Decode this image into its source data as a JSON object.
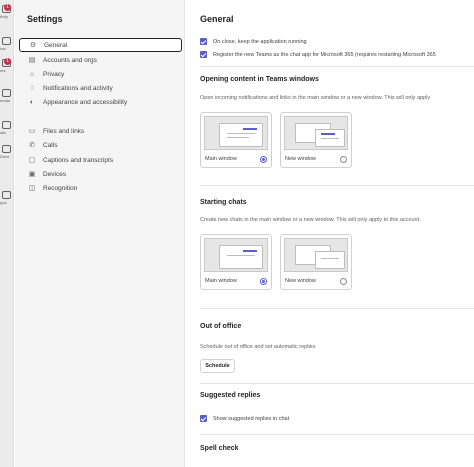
{
  "rail": {
    "items": [
      {
        "icon": "activity-icon",
        "caption": "tivity",
        "badge": "1"
      },
      {
        "icon": "chat-icon",
        "caption": "hat",
        "badge": ""
      },
      {
        "icon": "teams-icon",
        "caption": "ms",
        "badge": "1"
      },
      {
        "icon": "calendar-icon",
        "caption": "endar",
        "badge": ""
      },
      {
        "icon": "calls-icon",
        "caption": "alls",
        "badge": ""
      },
      {
        "icon": "onedrive-icon",
        "caption": "Drive",
        "badge": ""
      },
      {
        "icon": "apps-icon",
        "caption": "pps",
        "badge": ""
      }
    ]
  },
  "nav": {
    "title": "Settings",
    "items": [
      {
        "label": "General",
        "icon": "gear-icon"
      },
      {
        "label": "Accounts and orgs",
        "icon": "accounts-icon"
      },
      {
        "label": "Privacy",
        "icon": "lock-icon"
      },
      {
        "label": "Notifications and activity",
        "icon": "bell-icon"
      },
      {
        "label": "Appearance and accessibility",
        "icon": "appearance-icon"
      },
      {
        "label": "Files and links",
        "icon": "file-icon"
      },
      {
        "label": "Calls",
        "icon": "phone-icon"
      },
      {
        "label": "Captions and transcripts",
        "icon": "captions-icon"
      },
      {
        "label": "Devices",
        "icon": "devices-icon"
      },
      {
        "label": "Recognition",
        "icon": "recognition-icon"
      }
    ]
  },
  "main": {
    "title": "General",
    "checks_top": [
      "On close, keep the application running",
      "Register the new Teams as the chat app for Microsoft 365 (requires restarting Microsoft 365"
    ],
    "windows_section": {
      "title": "Opening content in Teams windows",
      "desc": "Open incoming notifications and links in the main window or a new window. This will only apply",
      "options": [
        "Main window",
        "New window"
      ]
    },
    "chats_section": {
      "title": "Starting chats",
      "desc": "Create new chats in the main window or a new window. This will only apply to this account.",
      "options": [
        "Main window",
        "New window"
      ]
    },
    "ooo_section": {
      "title": "Out of office",
      "desc": "Schedule out of office and set automatic replies",
      "button": "Schedule"
    },
    "replies_section": {
      "title": "Suggested replies",
      "check": "Show suggested replies in chat"
    },
    "spell_section": {
      "title": "Spell check"
    }
  },
  "colors": {
    "accent": "#5b5fc7",
    "badge": "#c4314b"
  }
}
